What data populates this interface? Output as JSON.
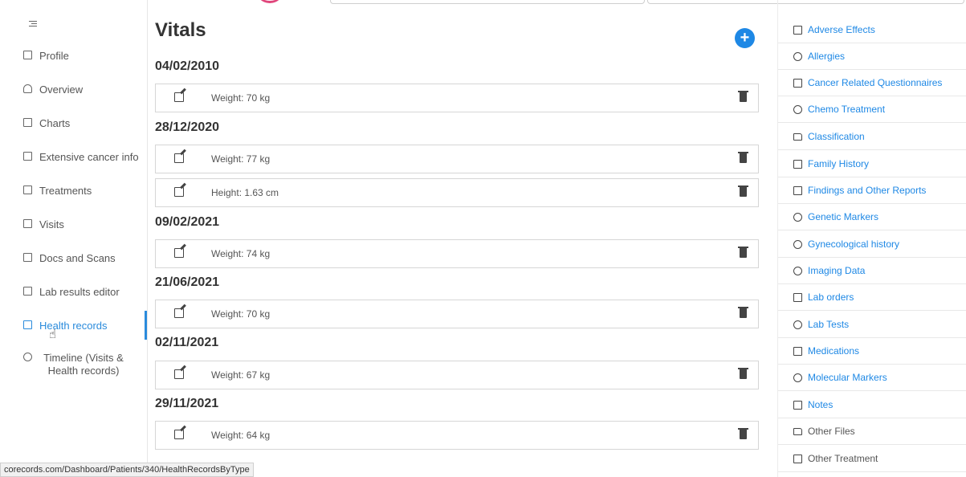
{
  "sidebar": {
    "items": [
      {
        "label": "Profile",
        "icon": "profile-card-icon"
      },
      {
        "label": "Overview",
        "icon": "person-icon"
      },
      {
        "label": "Charts",
        "icon": "chart-icon"
      },
      {
        "label": "Extensive cancer info",
        "icon": "clipboard-icon"
      },
      {
        "label": "Treatments",
        "icon": "flask-icon"
      },
      {
        "label": "Visits",
        "icon": "calendar-icon"
      },
      {
        "label": "Docs and Scans",
        "icon": "document-icon"
      },
      {
        "label": "Lab results editor",
        "icon": "table-icon"
      },
      {
        "label": "Health records",
        "icon": "records-icon",
        "active": true
      },
      {
        "label": "Timeline (Visits & Health records)",
        "icon": "clock-icon"
      }
    ]
  },
  "status_bar": {
    "url": "corecords.com/Dashboard/Patients/340/HealthRecordsByType"
  },
  "main": {
    "title": "Vitals",
    "add_label": "+",
    "groups": [
      {
        "date": "04/02/2010",
        "records": [
          "Weight: 70 kg"
        ]
      },
      {
        "date": "28/12/2020",
        "records": [
          "Weight: 77 kg",
          "Height: 1.63 cm"
        ]
      },
      {
        "date": "09/02/2021",
        "records": [
          "Weight: 74 kg"
        ]
      },
      {
        "date": "21/06/2021",
        "records": [
          "Weight: 70 kg"
        ]
      },
      {
        "date": "02/11/2021",
        "records": [
          "Weight: 67 kg"
        ]
      },
      {
        "date": "29/11/2021",
        "records": [
          "Weight: 64 kg"
        ]
      }
    ]
  },
  "right_panel": {
    "items": [
      {
        "label": "Adverse Effects",
        "link": true
      },
      {
        "label": "Allergies",
        "link": true
      },
      {
        "label": "Cancer Related Questionnaires",
        "link": true
      },
      {
        "label": "Chemo Treatment",
        "link": true
      },
      {
        "label": "Classification",
        "link": true
      },
      {
        "label": "Family History",
        "link": true
      },
      {
        "label": "Findings and Other Reports",
        "link": true
      },
      {
        "label": "Genetic Markers",
        "link": true
      },
      {
        "label": "Gynecological history",
        "link": true
      },
      {
        "label": "Imaging Data",
        "link": true
      },
      {
        "label": "Lab orders",
        "link": true
      },
      {
        "label": "Lab Tests",
        "link": true
      },
      {
        "label": "Medications",
        "link": true
      },
      {
        "label": "Molecular Markers",
        "link": true
      },
      {
        "label": "Notes",
        "link": true
      },
      {
        "label": "Other Files",
        "link": false
      },
      {
        "label": "Other Treatment",
        "link": false
      }
    ]
  },
  "colors": {
    "accent": "#1e88e5",
    "active": "#2a8bdc"
  }
}
